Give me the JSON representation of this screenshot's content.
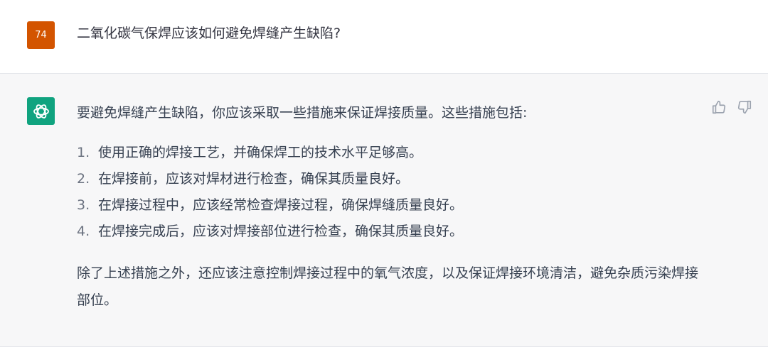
{
  "user_message": {
    "avatar_text": "74",
    "avatar_color": "#d35400",
    "text": "二氧化碳气保焊应该如何避免焊缝产生缺陷?"
  },
  "assistant_message": {
    "avatar_color": "#10a37f",
    "avatar_icon": "openai-logo-icon",
    "intro": "要避免焊缝产生缺陷，你应该采取一些措施来保证焊接质量。这些措施包括:",
    "list": [
      {
        "num": "1.",
        "text": "使用正确的焊接工艺，并确保焊工的技术水平足够高。"
      },
      {
        "num": "2.",
        "text": "在焊接前，应该对焊材进行检查，确保其质量良好。"
      },
      {
        "num": "3.",
        "text": "在焊接过程中，应该经常检查焊接过程，确保焊缝质量良好。"
      },
      {
        "num": "4.",
        "text": "在焊接完成后，应该对焊接部位进行检查，确保其质量良好。"
      }
    ],
    "closing": "除了上述措施之外，还应该注意控制焊接过程中的氧气浓度，以及保证焊接环境清洁，避免杂质污染焊接部位。",
    "feedback_icons": [
      "thumbs-up-icon",
      "thumbs-down-icon"
    ]
  }
}
